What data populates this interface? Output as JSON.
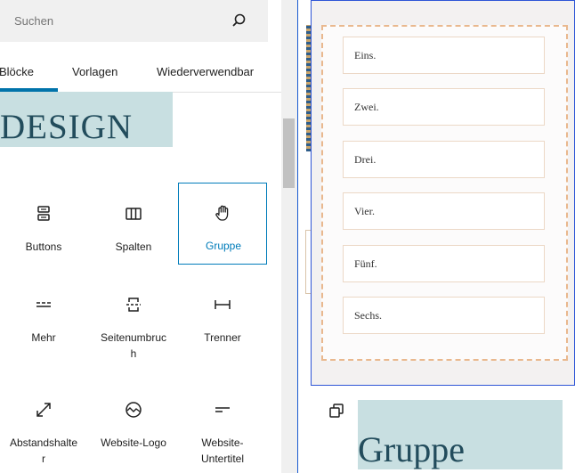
{
  "inserter": {
    "search": {
      "placeholder": "Suchen",
      "value": ""
    },
    "tabs": [
      {
        "label": "Blöcke",
        "active": true
      },
      {
        "label": "Vorlagen",
        "active": false
      },
      {
        "label": "Wiederverwendbar",
        "active": false
      }
    ],
    "design_heading": "DESIGN",
    "blocks": [
      {
        "label": "Buttons",
        "icon": "buttons-icon",
        "selected": false
      },
      {
        "label": "Spalten",
        "icon": "columns-icon",
        "selected": false
      },
      {
        "label": "Gruppe",
        "icon": "grab-hand-icon",
        "selected": true
      },
      {
        "label": "Mehr",
        "icon": "more-icon",
        "selected": false
      },
      {
        "label": "Seitenumbruc h",
        "icon": "page-break-icon",
        "selected": false
      },
      {
        "label": "Trenner",
        "icon": "separator-icon",
        "selected": false
      },
      {
        "label": "Abstandshalte r",
        "icon": "spacer-icon",
        "selected": false
      },
      {
        "label": "Website-Logo",
        "icon": "site-logo-icon",
        "selected": false
      },
      {
        "label": "Website-Untertitel",
        "icon": "site-tagline-icon",
        "selected": false
      }
    ]
  },
  "canvas": {
    "group_items": [
      "Eins.",
      "Zwei.",
      "Drei.",
      "Vier.",
      "Fünf.",
      "Sechs."
    ],
    "gruppe_heading": "Gruppe"
  },
  "colors": {
    "accent": "#007cba",
    "selection_border": "#2e55d6",
    "dashed_border": "#e9b88e",
    "heading_bg": "#c8dfe1",
    "heading_text": "#224c5c"
  }
}
